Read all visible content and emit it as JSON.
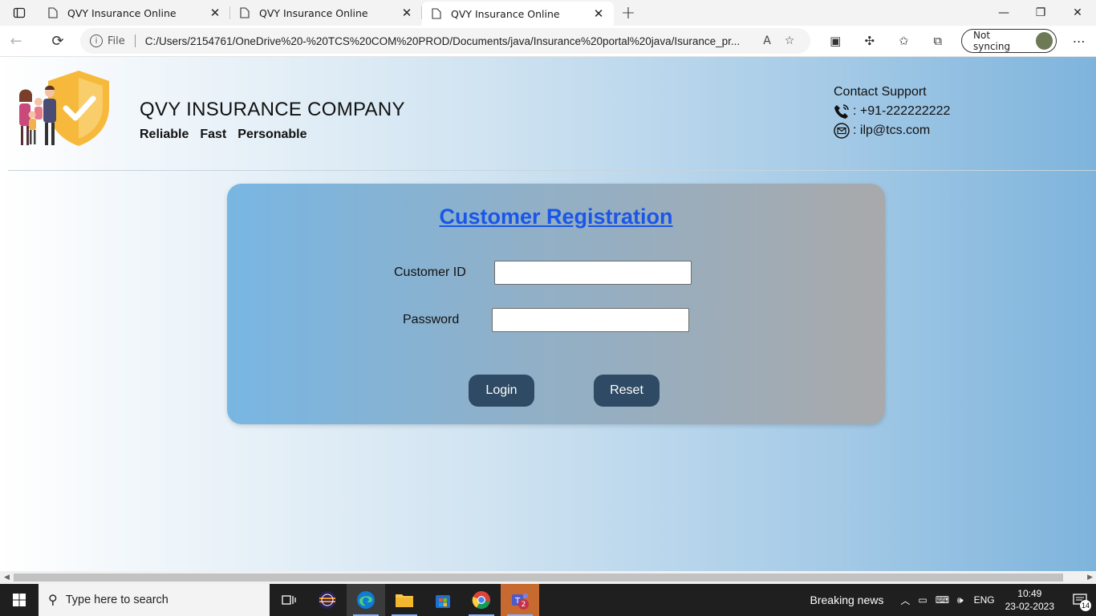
{
  "browser": {
    "tabs": [
      {
        "title": "QVY Insurance Online",
        "active": false
      },
      {
        "title": "QVY Insurance Online",
        "active": false
      },
      {
        "title": "QVY Insurance Online",
        "active": true
      }
    ],
    "address": {
      "scheme_label": "File",
      "url": "C:/Users/2154761/OneDrive%20-%20TCS%20COM%20PROD/Documents/java/Insurance%20portal%20java/Isurance_pr..."
    },
    "sync_label": "Not syncing"
  },
  "header": {
    "company": "QVY INSURANCE COMPANY",
    "tagline": [
      "Reliable",
      "Fast",
      "Personable"
    ],
    "contact": {
      "title": "Contact Support",
      "phone": ": +91-222222222",
      "email": ": ilp@tcs.com"
    }
  },
  "form": {
    "title": "Customer Registration",
    "customer_id_label": "Customer ID",
    "customer_id_value": "",
    "password_label": "Password",
    "password_value": "",
    "login_label": "Login",
    "reset_label": "Reset"
  },
  "taskbar": {
    "search_placeholder": "Type here to search",
    "news": "Breaking news",
    "lang": "ENG",
    "time": "10:49",
    "date": "23-02-2023",
    "notifications": "14",
    "teams_badge": "2"
  }
}
